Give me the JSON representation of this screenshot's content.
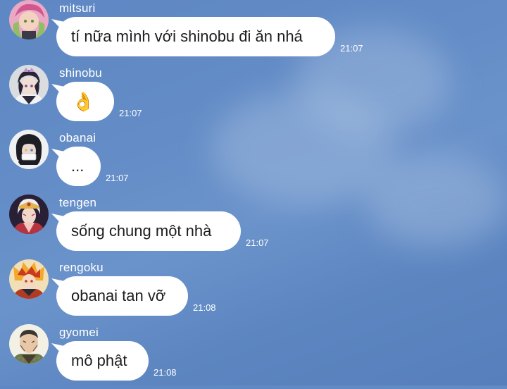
{
  "messages": [
    {
      "sender": "mitsuri",
      "text": "tí nữa mình với shinobu đi ăn nhá",
      "time": "21:07",
      "avatar_icon": "mitsuri-avatar"
    },
    {
      "sender": "shinobu",
      "text": "👌",
      "time": "21:07",
      "avatar_icon": "shinobu-avatar"
    },
    {
      "sender": "obanai",
      "text": "...",
      "time": "21:07",
      "avatar_icon": "obanai-avatar"
    },
    {
      "sender": "tengen",
      "text": "sống chung một nhà",
      "time": "21:07",
      "avatar_icon": "tengen-avatar"
    },
    {
      "sender": "rengoku",
      "text": "obanai tan vỡ",
      "time": "21:08",
      "avatar_icon": "rengoku-avatar"
    },
    {
      "sender": "gyomei",
      "text": "mô phật",
      "time": "21:08",
      "avatar_icon": "gyomei-avatar"
    }
  ],
  "colors": {
    "background": "#6189c4",
    "bubble": "#ffffff",
    "meta_text": "#ffffff"
  }
}
